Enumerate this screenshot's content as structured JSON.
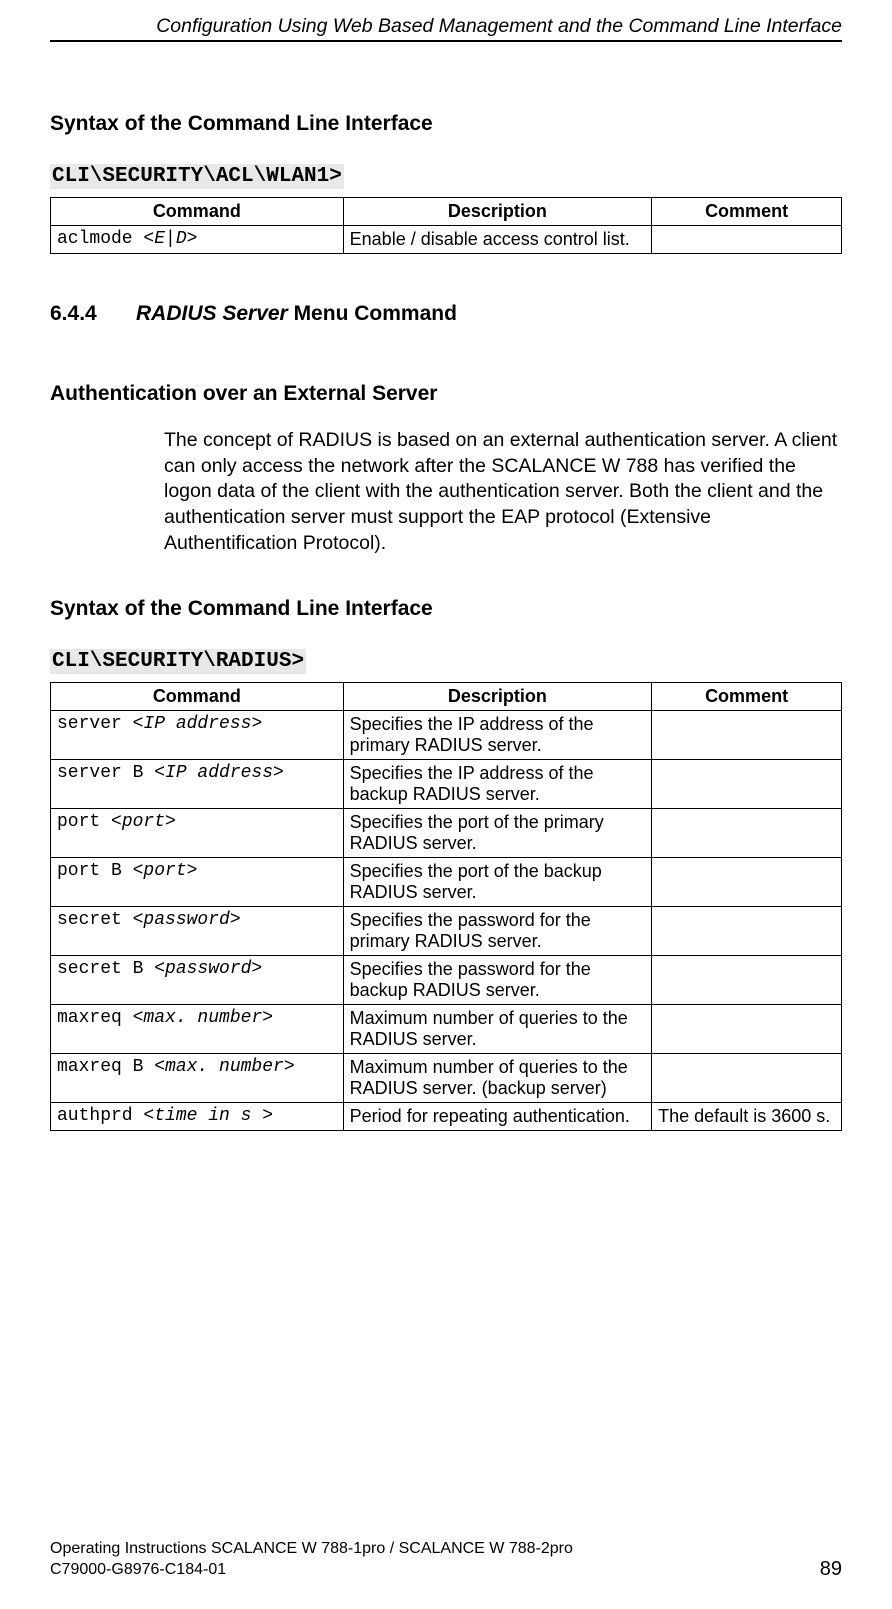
{
  "header": {
    "running": "Configuration Using Web Based Management and the Command Line Interface"
  },
  "section1": {
    "heading": "Syntax of the Command Line Interface",
    "cliPath": "CLI\\SECURITY\\ACL\\WLAN1>",
    "cols": {
      "c1": "Command",
      "c2": "Description",
      "c3": "Comment"
    },
    "rows": [
      {
        "cmd_plain": "aclmode ",
        "cmd_arg": "<E|D>",
        "desc": "Enable / disable access control list.",
        "comment": ""
      }
    ]
  },
  "section2": {
    "num": "6.4.4",
    "title_pre": "RADIUS Server",
    "title_post": " Menu Command"
  },
  "auth": {
    "heading": "Authentication over an External Server",
    "para": "The concept of RADIUS is based on an external authentication server. A client can only access the network after the SCALANCE W 788 has verified the logon data of the client with the authentication server. Both the client and the authentication server must support the EAP protocol (Extensive Authentification Protocol)."
  },
  "section3": {
    "heading": "Syntax of the Command Line Interface",
    "cliPath": "CLI\\SECURITY\\RADIUS>",
    "cols": {
      "c1": "Command",
      "c2": "Description",
      "c3": "Comment"
    },
    "rows": [
      {
        "cmd_plain": "server ",
        "cmd_arg": "<IP address>",
        "desc": "Specifies the IP address of the primary RADIUS server.",
        "comment": ""
      },
      {
        "cmd_plain": "server B ",
        "cmd_arg": "<IP address>",
        "desc": "Specifies the IP address of the backup RADIUS server.",
        "comment": ""
      },
      {
        "cmd_plain": "port ",
        "cmd_arg": "<port>",
        "desc": "Specifies the port of the primary RADIUS server.",
        "comment": ""
      },
      {
        "cmd_plain": "port B ",
        "cmd_arg": "<port>",
        "desc": "Specifies the port of the backup RADIUS server.",
        "comment": ""
      },
      {
        "cmd_plain": "secret ",
        "cmd_arg": "<password>",
        "desc": "Specifies the password for the primary RADIUS server.",
        "comment": ""
      },
      {
        "cmd_plain": "secret B ",
        "cmd_arg": "<password>",
        "desc": "Specifies the password for the backup RADIUS server.",
        "comment": ""
      },
      {
        "cmd_plain": "maxreq ",
        "cmd_arg": "<max. number>",
        "desc": "Maximum number of queries to the RADIUS server.",
        "comment": ""
      },
      {
        "cmd_plain": "maxreq B ",
        "cmd_arg": "<max. number>",
        "desc": "Maximum number of queries to the RADIUS server. (backup server)",
        "comment": ""
      },
      {
        "cmd_plain": "authprd ",
        "cmd_arg": "<time in s >",
        "desc": "Period for repeating authentication.",
        "comment": "The default is 3600 s."
      }
    ]
  },
  "footer": {
    "line1": "Operating Instructions SCALANCE W 788-1pro / SCALANCE W 788-2pro",
    "line2": "C79000-G8976-C184-01",
    "page": "89"
  }
}
